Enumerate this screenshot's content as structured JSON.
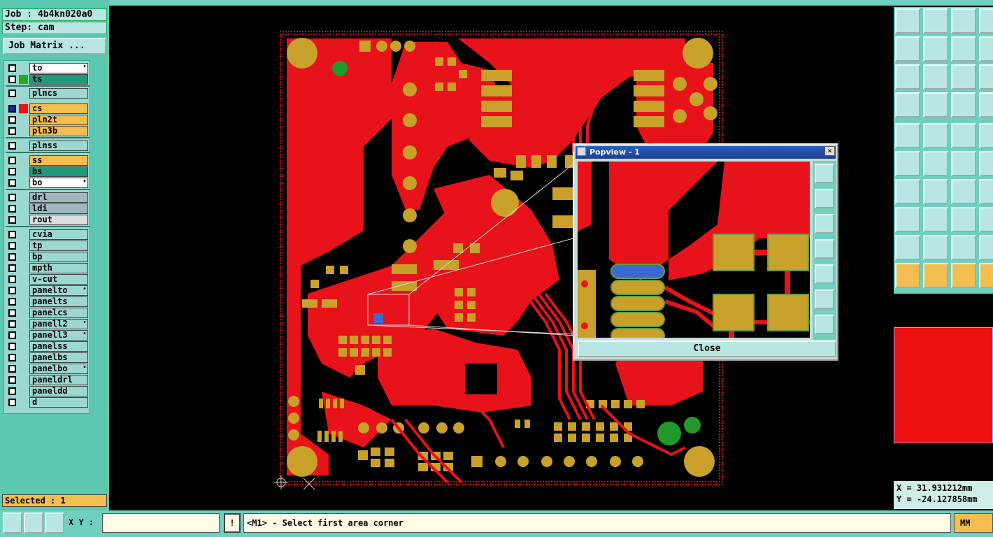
{
  "header": {
    "job": "Job : 4b4kn020a0",
    "step": "Step: cam",
    "job_matrix": "Job Matrix ..."
  },
  "layers": [
    {
      "name": "to",
      "color": "#ffffff"
    },
    {
      "name": "ts",
      "color": "#1f9a7a"
    },
    {
      "name": "plncs",
      "color": "#9bd8d0"
    },
    {
      "name": "cs",
      "color": "#f3bd4f"
    },
    {
      "name": "pln2t",
      "color": "#f3bd4f"
    },
    {
      "name": "pln3b",
      "color": "#f3bd4f"
    },
    {
      "name": "plnss",
      "color": "#9bd8d0"
    },
    {
      "name": "ss",
      "color": "#f3bd4f"
    },
    {
      "name": "bs",
      "color": "#1f9a7a"
    },
    {
      "name": "bo",
      "color": "#ffffff"
    },
    {
      "name": "drl",
      "color": "#9fb6bf"
    },
    {
      "name": "ldi",
      "color": "#9fb6bf"
    },
    {
      "name": "rout",
      "color": "#dddddd"
    },
    {
      "name": "cvia",
      "color": "#9bd8d0"
    },
    {
      "name": "tp",
      "color": "#9bd8d0"
    },
    {
      "name": "bp",
      "color": "#9bd8d0"
    },
    {
      "name": "mpth",
      "color": "#9bd8d0"
    },
    {
      "name": "v-cut",
      "color": "#9bd8d0"
    },
    {
      "name": "panelto",
      "color": "#9bd8d0"
    },
    {
      "name": "panelts",
      "color": "#9bd8d0"
    },
    {
      "name": "panelcs",
      "color": "#9bd8d0"
    },
    {
      "name": "panell2",
      "color": "#9bd8d0"
    },
    {
      "name": "panell3",
      "color": "#9bd8d0"
    },
    {
      "name": "panelss",
      "color": "#9bd8d0"
    },
    {
      "name": "panelbs",
      "color": "#9bd8d0"
    },
    {
      "name": "panelbo",
      "color": "#9bd8d0"
    },
    {
      "name": "paneldrl",
      "color": "#9bd8d0"
    },
    {
      "name": "paneldd",
      "color": "#9bd8d0"
    },
    {
      "name": "d",
      "color": "#9bd8d0"
    }
  ],
  "selected": "Selected : 1",
  "popup": {
    "title": "Popview - 1",
    "close_label": "Close",
    "close_x": "×"
  },
  "coords": {
    "x": "X = 31.931212mm",
    "y": "Y = -24.127858mm"
  },
  "bottom": {
    "xy_label": "X Y :",
    "xy_value": "",
    "excl": "!",
    "status": "<M1> - Select first area corner",
    "unit": "MM"
  },
  "colors": {
    "copper": "#e8121a",
    "pad": "#c8a02a",
    "panel": "#5cc8b0",
    "accent": "#f3bd4f"
  }
}
